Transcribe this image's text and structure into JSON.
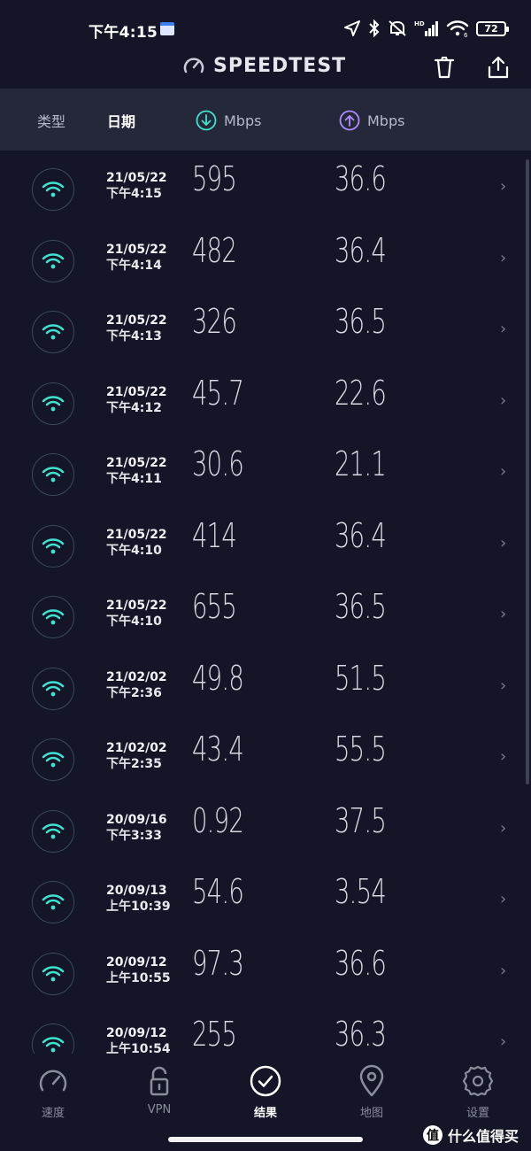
{
  "status_bar": {
    "time": "下午4:15",
    "network_label": "HD",
    "signal_bars": "5G",
    "wifi_small": "6",
    "battery": "72"
  },
  "header": {
    "brand": "SPEEDTEST",
    "icons": [
      "speedometer-icon",
      "trash-icon",
      "share-icon"
    ]
  },
  "columns": {
    "type": "类型",
    "date": "日期",
    "download": "Mbps",
    "upload": "Mbps"
  },
  "colors": {
    "background": "#141526",
    "header_bg": "#252838",
    "wifi": "#3ee3d0",
    "download_accent": "#3ee3d0",
    "upload_accent": "#b08cff"
  },
  "results": [
    {
      "date": "21/05/22",
      "time": "下午4:15",
      "download": "595",
      "upload": "36.6"
    },
    {
      "date": "21/05/22",
      "time": "下午4:14",
      "download": "482",
      "upload": "36.4"
    },
    {
      "date": "21/05/22",
      "time": "下午4:13",
      "download": "326",
      "upload": "36.5"
    },
    {
      "date": "21/05/22",
      "time": "下午4:12",
      "download": "45.7",
      "upload": "22.6"
    },
    {
      "date": "21/05/22",
      "time": "下午4:11",
      "download": "30.6",
      "upload": "21.1"
    },
    {
      "date": "21/05/22",
      "time": "下午4:10",
      "download": "414",
      "upload": "36.4"
    },
    {
      "date": "21/05/22",
      "time": "下午4:10",
      "download": "655",
      "upload": "36.5"
    },
    {
      "date": "21/02/02",
      "time": "下午2:36",
      "download": "49.8",
      "upload": "51.5"
    },
    {
      "date": "21/02/02",
      "time": "下午2:35",
      "download": "43.4",
      "upload": "55.5"
    },
    {
      "date": "20/09/16",
      "time": "下午3:33",
      "download": "0.92",
      "upload": "37.5"
    },
    {
      "date": "20/09/13",
      "time": "上午10:39",
      "download": "54.6",
      "upload": "3.54"
    },
    {
      "date": "20/09/12",
      "time": "上午10:55",
      "download": "97.3",
      "upload": "36.6"
    },
    {
      "date": "20/09/12",
      "time": "上午10:54",
      "download": "255",
      "upload": "36.3"
    }
  ],
  "nav": {
    "items": [
      {
        "label": "速度",
        "icon": "speedometer-icon",
        "active": false
      },
      {
        "label": "VPN",
        "icon": "lock-icon",
        "active": false
      },
      {
        "label": "结果",
        "icon": "check-circle-icon",
        "active": true
      },
      {
        "label": "地图",
        "icon": "map-pin-icon",
        "active": false
      },
      {
        "label": "设置",
        "icon": "gear-icon",
        "active": false
      }
    ]
  },
  "watermark": {
    "logo": "值",
    "text": "什么值得买"
  }
}
